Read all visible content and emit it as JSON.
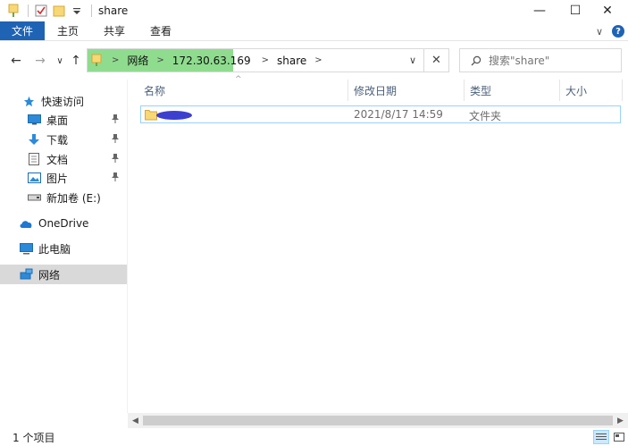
{
  "window": {
    "title": "share",
    "controls": {
      "minimize": "—",
      "maximize": "☐",
      "close": "✕"
    }
  },
  "ribbon": {
    "tabs": [
      "文件",
      "主页",
      "共享",
      "查看"
    ],
    "collapse_glyph": "∨",
    "help_glyph": "?"
  },
  "nav": {
    "back": "←",
    "forward": "→",
    "recent": "∨",
    "up": "↑",
    "breadcrumbs": [
      "网络",
      "172.30.63.169",
      "share"
    ],
    "chevron": ">",
    "dropdown": "∨",
    "clear": "✕"
  },
  "search": {
    "placeholder": "搜索\"share\""
  },
  "sidebar": {
    "quick_access": "快速访问",
    "items": [
      {
        "label": "桌面",
        "icon": "desktop-icon"
      },
      {
        "label": "下载",
        "icon": "download-icon"
      },
      {
        "label": "文档",
        "icon": "documents-icon"
      },
      {
        "label": "图片",
        "icon": "pictures-icon"
      },
      {
        "label": "新加卷 (E:)",
        "icon": "drive-icon"
      }
    ],
    "onedrive": "OneDrive",
    "this_pc": "此电脑",
    "network": "网络"
  },
  "columns": [
    "名称",
    "修改日期",
    "类型",
    "大小"
  ],
  "files": [
    {
      "name": "",
      "modified": "2021/8/17 14:59",
      "type": "文件夹",
      "size": ""
    }
  ],
  "status": {
    "item_count": "1 个项目"
  },
  "colors": {
    "accent": "#1f63b4",
    "address_highlight": "#8fdc8f",
    "folder": "#f8d775",
    "selection_border": "#99d1ff",
    "redaction": "#3d3fcf"
  }
}
